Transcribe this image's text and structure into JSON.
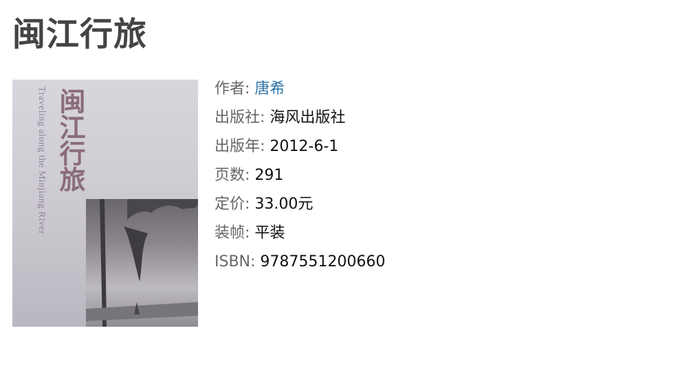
{
  "page": {
    "title": "闽江行旅"
  },
  "cover": {
    "title_text": "闽江行旅",
    "subtitle_text": "Traveling along the Minjiang River"
  },
  "details": {
    "author_label": "作者",
    "author_value": "唐希",
    "publisher_label": "出版社",
    "publisher_value": "海风出版社",
    "pubdate_label": "出版年",
    "pubdate_value": "2012-6-1",
    "pages_label": "页数",
    "pages_value": "291",
    "price_label": "定价",
    "price_value": "33.00元",
    "binding_label": "装帧",
    "binding_value": "平装",
    "isbn_label": "ISBN",
    "isbn_value": "9787551200660"
  },
  "colors": {
    "link": "#2f73a6",
    "label": "#666666",
    "title": "#444444"
  }
}
